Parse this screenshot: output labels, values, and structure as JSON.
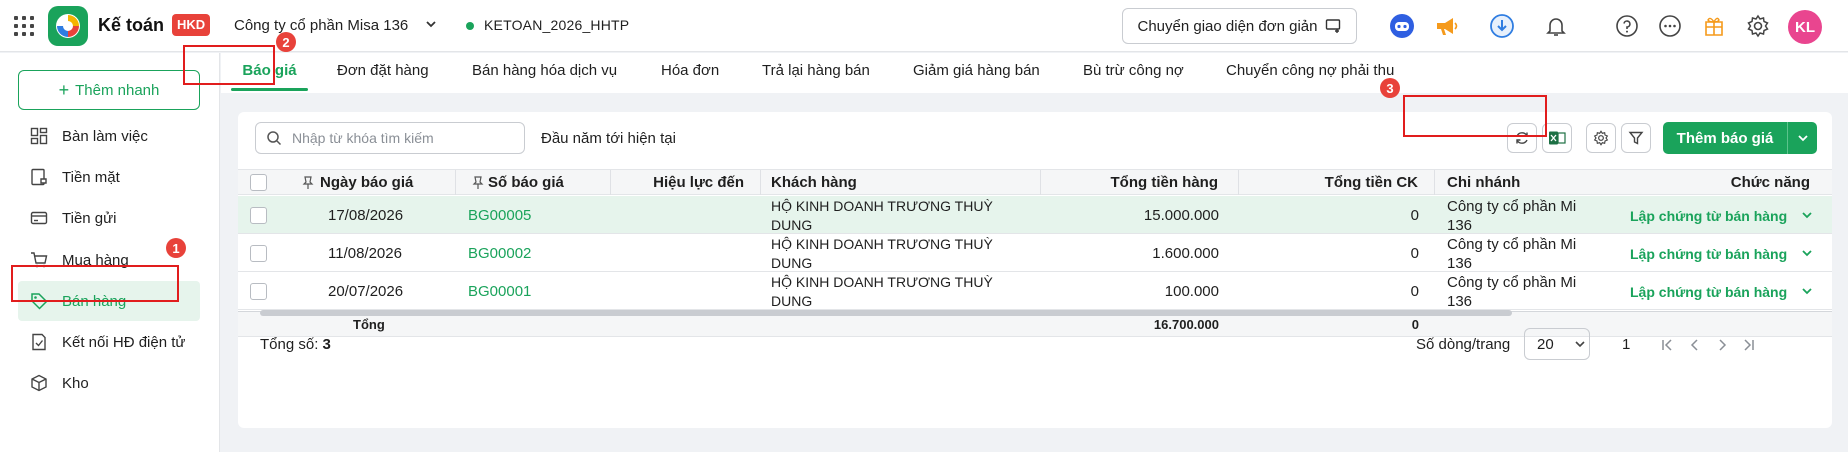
{
  "header": {
    "app_name": "Kế toán",
    "badge": "HKD",
    "company": "Công ty cổ phần Misa 136",
    "database": "KETOAN_2026_HHTP",
    "simple_ui_button": "Chuyển giao diện đơn giản",
    "avatar_initials": "KL",
    "accent_color": "#1aa35b"
  },
  "sidebar": {
    "quick_add": "Thêm nhanh",
    "items": [
      {
        "label": "Bàn làm việc",
        "icon": "dashboard-icon"
      },
      {
        "label": "Tiền mặt",
        "icon": "cash-icon"
      },
      {
        "label": "Tiền gửi",
        "icon": "bank-card-icon"
      },
      {
        "label": "Mua hàng",
        "icon": "cart-icon"
      },
      {
        "label": "Bán hàng",
        "icon": "tag-icon",
        "active": true
      },
      {
        "label": "Kết nối HĐ điện tử",
        "icon": "e-invoice-icon"
      },
      {
        "label": "Kho",
        "icon": "box-icon"
      }
    ]
  },
  "tabs": [
    {
      "label": "Báo giá",
      "active": true
    },
    {
      "label": "Đơn đặt hàng"
    },
    {
      "label": "Bán hàng hóa dịch vụ"
    },
    {
      "label": "Hóa đơn"
    },
    {
      "label": "Trả lại hàng bán"
    },
    {
      "label": "Giảm giá hàng bán"
    },
    {
      "label": "Bù trừ công nợ"
    },
    {
      "label": "Chuyển công nợ phải thu"
    }
  ],
  "toolbar": {
    "search_placeholder": "Nhập từ khóa tìm kiếm",
    "period": "Đầu năm tới hiện tại",
    "add_button": "Thêm báo giá"
  },
  "table": {
    "columns": [
      "Ngày báo giá",
      "Số báo giá",
      "Hiệu lực đến",
      "Khách hàng",
      "Tổng tiền hàng",
      "Tổng tiền CK",
      "Chi nhánh",
      "Chức năng"
    ],
    "rows": [
      {
        "date": "17/08/2026",
        "number": "BG00005",
        "valid_until": "",
        "customer_1": "HỘ KINH DOANH TRƯƠNG THUỲ",
        "customer_2": "DUNG",
        "total": "15.000.000",
        "discount": "0",
        "branch_1": "Công ty cổ phần Mi",
        "branch_2": "136",
        "action": "Lập chứng từ bán hàng"
      },
      {
        "date": "11/08/2026",
        "number": "BG00002",
        "valid_until": "",
        "customer_1": "HỘ KINH DOANH TRƯƠNG THUỲ",
        "customer_2": "DUNG",
        "total": "1.600.000",
        "discount": "0",
        "branch_1": "Công ty cổ phần Mi",
        "branch_2": "136",
        "action": "Lập chứng từ bán hàng"
      },
      {
        "date": "20/07/2026",
        "number": "BG00001",
        "valid_until": "",
        "customer_1": "HỘ KINH DOANH TRƯƠNG THUỲ",
        "customer_2": "DUNG",
        "total": "100.000",
        "discount": "0",
        "branch_1": "Công ty cổ phần Mi",
        "branch_2": "136",
        "action": "Lập chứng từ bán hàng"
      }
    ],
    "summary": {
      "label": "Tổng",
      "total": "16.700.000",
      "discount": "0"
    }
  },
  "footer": {
    "total_label": "Tổng số:",
    "total_count": "3",
    "rows_per_page_label": "Số dòng/trang",
    "rows_per_page": "20",
    "page": "1"
  },
  "annotations": [
    "1",
    "2",
    "3"
  ]
}
